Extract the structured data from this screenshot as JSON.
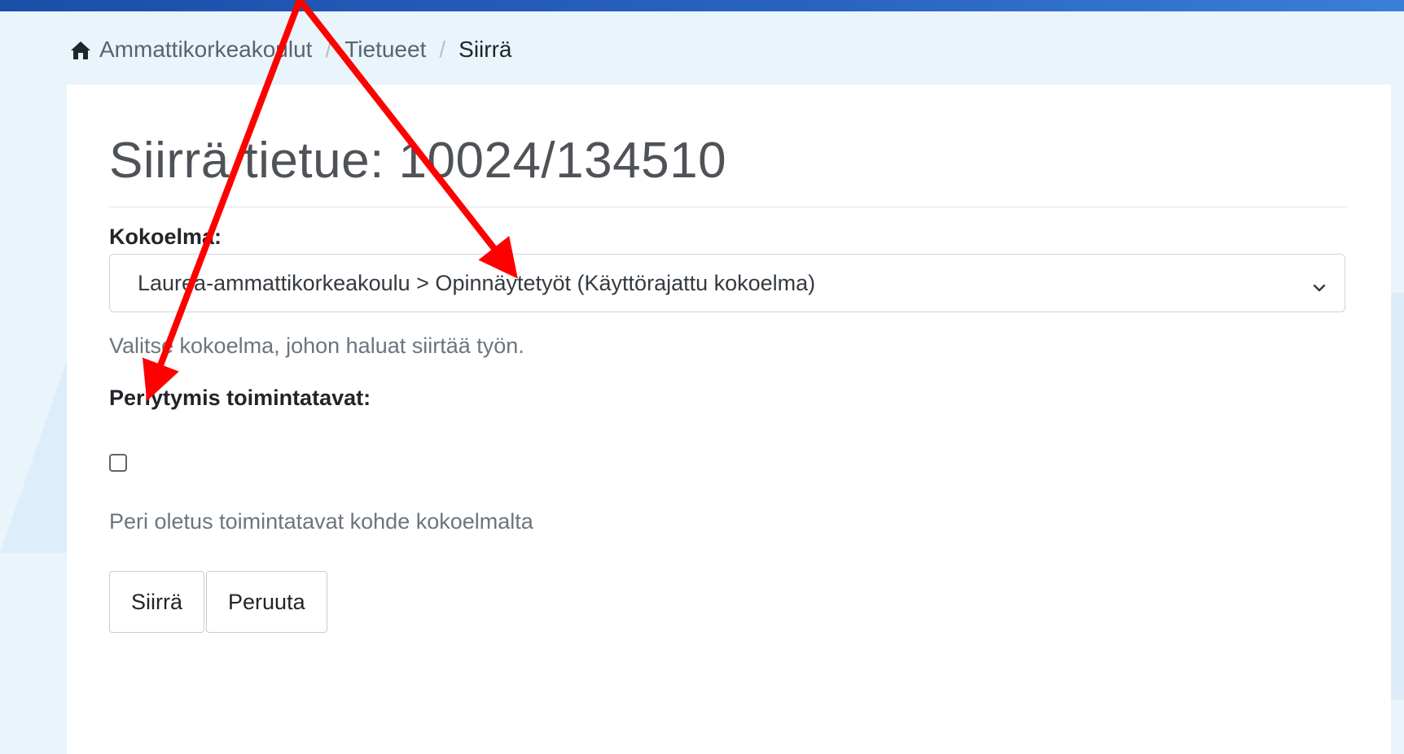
{
  "breadcrumb": {
    "home": "Ammattikorkeakoulut",
    "item2": "Tietueet",
    "current": "Siirrä",
    "separator": "/"
  },
  "page": {
    "title": "Siirrä tietue: 10024/134510"
  },
  "form": {
    "collection_label": "Kokoelma:",
    "collection_selected": "Laurea-ammattikorkeakoulu > Opinnäytetyöt (Käyttörajattu kokoelma)",
    "collection_help": "Valitse kokoelma, johon haluat siirtää työn.",
    "inheritance_label": "Perlytymis toimintatavat:",
    "inheritance_help": "Peri oletus toimintatavat kohde kokoelmalta"
  },
  "buttons": {
    "move": "Siirrä",
    "cancel": "Peruuta"
  },
  "colors": {
    "top_bar": "#1a4fa8",
    "background": "#e9f4fb",
    "annotation_arrow": "#ff0000"
  },
  "icons": {
    "home": "home-icon",
    "chevron": "chevron-down-icon"
  }
}
